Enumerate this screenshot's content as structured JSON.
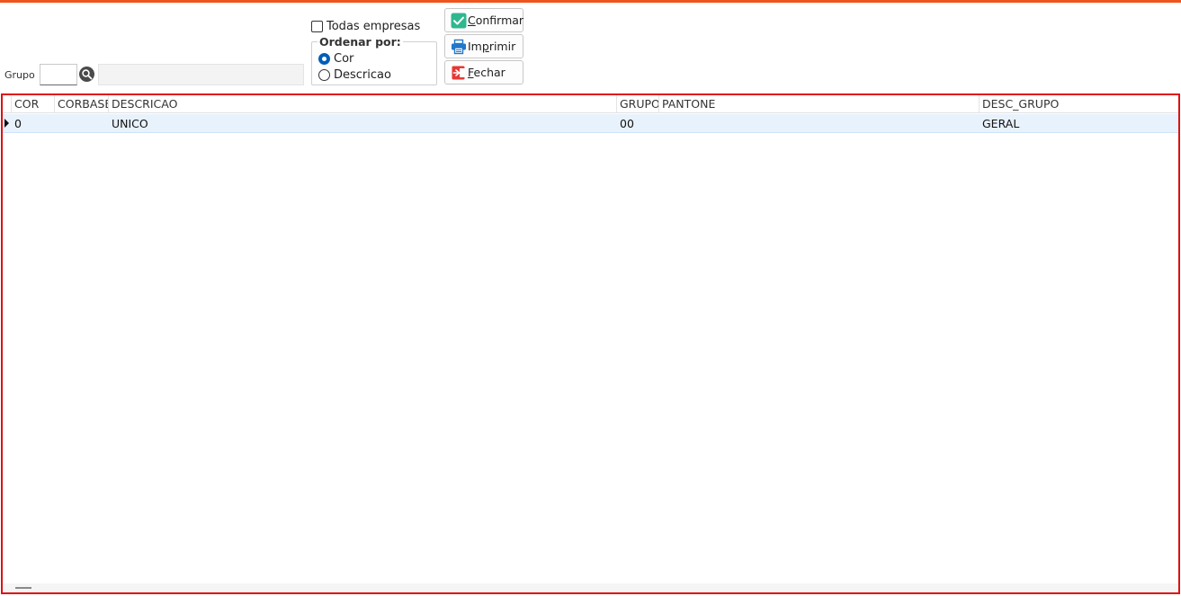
{
  "filters": {
    "grupo_label": "Grupo",
    "grupo_value": "",
    "grupo_desc": ""
  },
  "options": {
    "todas_empresas": "Todas empresas",
    "order_title": "Ordenar por:",
    "order_options": [
      "Cor",
      "Descricao"
    ],
    "order_selected": "Cor"
  },
  "actions": {
    "confirmar": "Confirmar",
    "imprimir": "Imprimir",
    "fechar": "Fechar"
  },
  "grid": {
    "columns": [
      "COR",
      "CORBASE",
      "DESCRICAO",
      "GRUPO",
      "PANTONE",
      "DESC_GRUPO"
    ],
    "rows": [
      [
        "0",
        "",
        "UNICO",
        "00",
        "",
        "GERAL"
      ]
    ]
  },
  "colors": {
    "accent": "#f0541e",
    "grid_border": "#e01010",
    "selected_row": "#e8f2fc"
  }
}
